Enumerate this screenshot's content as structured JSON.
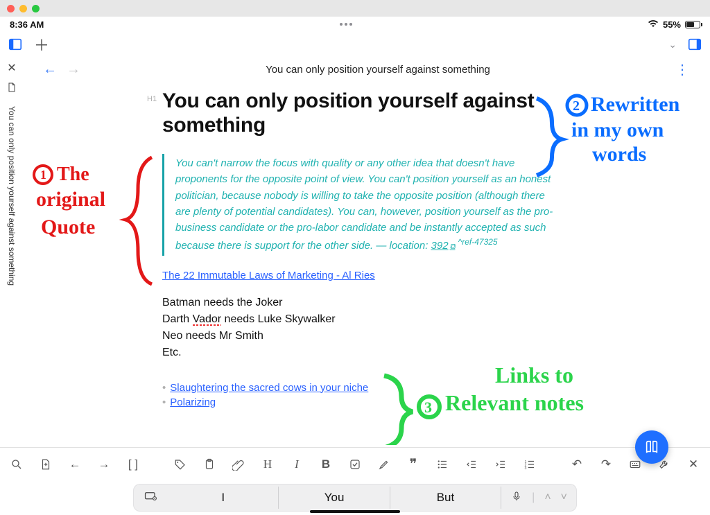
{
  "status": {
    "time": "8:36 AM",
    "battery_pct": "55%"
  },
  "toolbar": {},
  "document": {
    "breadcrumb": "You can only position yourself against something",
    "tab_title": "You can only position yourself against something",
    "h1_label": "H1",
    "title": "You can only position yourself against something",
    "quote": "You can't narrow the focus with quality or any other idea that doesn't have proponents for the opposite point of view. You can't position yourself as an honest politician, because nobody is willing to take the opposite position (although there are plenty of potential candidates). You can, however, position yourself as the pro-business candidate or the pro-labor candidate and be instantly accepted as such because there is support for the other side. — location: ",
    "location_num": "392",
    "ref": "^ref-47325",
    "source_link": "The 22 Immutable Laws of Marketing - Al Ries",
    "lines": {
      "l1a": "Batman needs the Joker",
      "l2a": "Darth ",
      "l2b": "Vador",
      "l2c": " needs Luke Skywalker",
      "l3": "Neo needs Mr Smith",
      "l4": "Etc."
    },
    "related": {
      "a": "Slaughtering the sacred cows in your niche",
      "b": "Polarizing"
    }
  },
  "keyboard": {
    "s1": "I",
    "s2": "You",
    "s3": "But"
  },
  "annotations": {
    "red_num": "1",
    "red_text_l1": "The",
    "red_text_l2": "original",
    "red_text_l3": "Quote",
    "blue_num": "2",
    "blue_l1": "Rewritten",
    "blue_l2": "in my own",
    "blue_l3": "words",
    "green_num": "3",
    "green_l1": "Links to",
    "green_l2": "Relevant notes"
  }
}
